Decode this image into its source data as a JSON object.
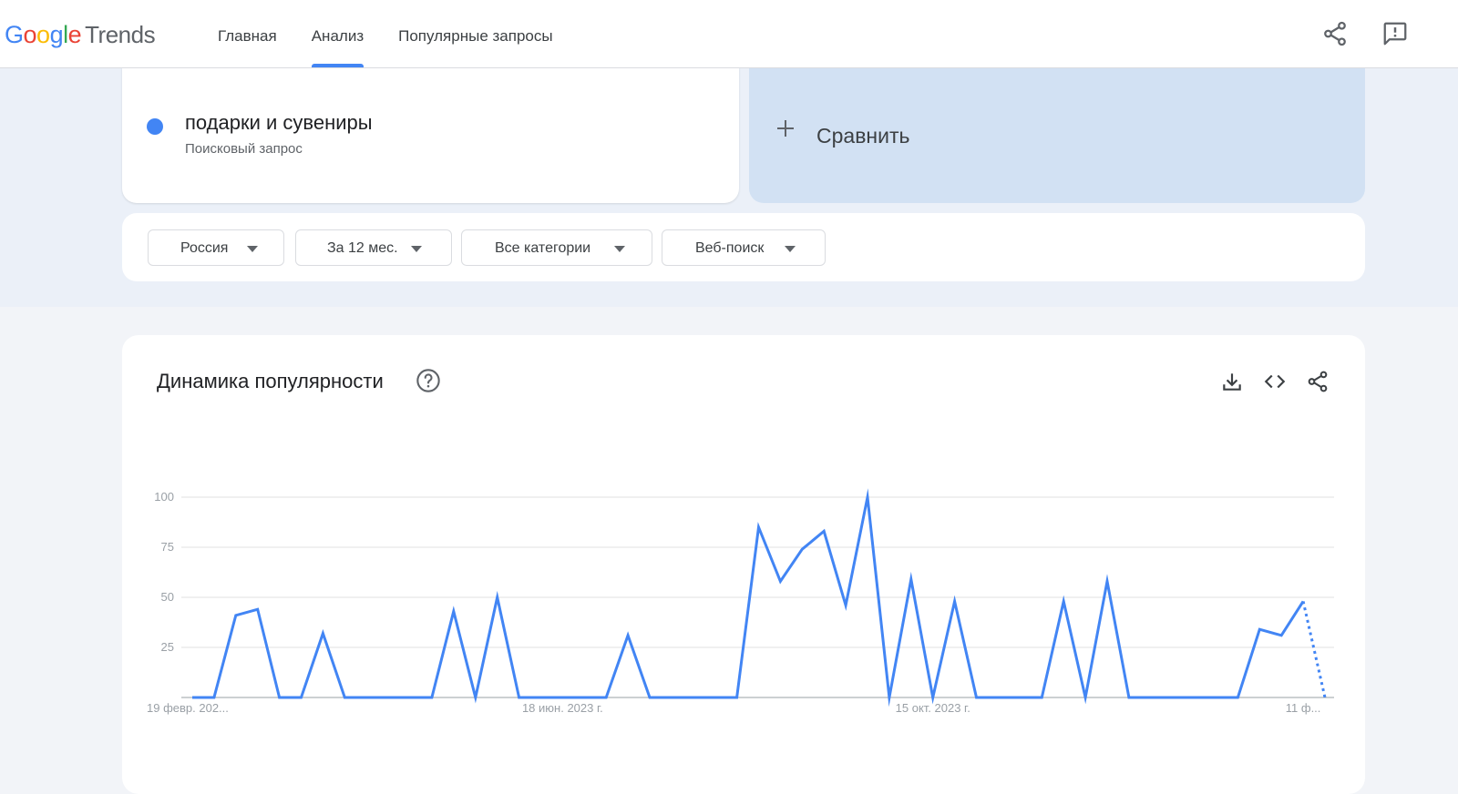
{
  "header": {
    "logo": {
      "google": "Google",
      "trends": "Trends"
    },
    "tabs": [
      {
        "label": "Главная",
        "active": false
      },
      {
        "label": "Анализ",
        "active": true
      },
      {
        "label": "Популярные запросы",
        "active": false
      }
    ],
    "share_icon": "share-icon",
    "feedback_icon": "feedback-icon"
  },
  "term": {
    "name": "подарки и сувениры",
    "type": "Поисковый запрос",
    "color": "#4285f4"
  },
  "compare": {
    "label": "Сравнить",
    "icon": "plus-icon"
  },
  "filters": [
    {
      "label": "Россия"
    },
    {
      "label": "За 12 мес."
    },
    {
      "label": "Все категории"
    },
    {
      "label": "Веб-поиск"
    }
  ],
  "chart_card": {
    "title": "Динамика популярности",
    "help_icon": "help-icon",
    "download_icon": "download-icon",
    "embed_icon": "embed-icon",
    "share_icon": "share-icon"
  },
  "chart_data": {
    "type": "line",
    "title": "Динамика популярности",
    "xlabel": "",
    "ylabel": "",
    "ylim": [
      0,
      100
    ],
    "yticks": [
      25,
      50,
      75,
      100
    ],
    "xtick_labels": [
      "19 февр. 202...",
      "18 июн. 2023 г.",
      "15 окт. 2023 г.",
      "11 ф..."
    ],
    "xtick_index": [
      0,
      17,
      34,
      51
    ],
    "grid": true,
    "color": "#4285f4",
    "partial_from_index": 51,
    "values": [
      0,
      0,
      41,
      44,
      0,
      0,
      32,
      0,
      0,
      0,
      0,
      0,
      43,
      0,
      50,
      0,
      0,
      0,
      0,
      0,
      31,
      0,
      0,
      0,
      0,
      0,
      85,
      58,
      74,
      83,
      46,
      100,
      0,
      59,
      0,
      48,
      0,
      0,
      0,
      0,
      48,
      0,
      58,
      0,
      0,
      0,
      0,
      0,
      0,
      34,
      31,
      48,
      0
    ]
  }
}
